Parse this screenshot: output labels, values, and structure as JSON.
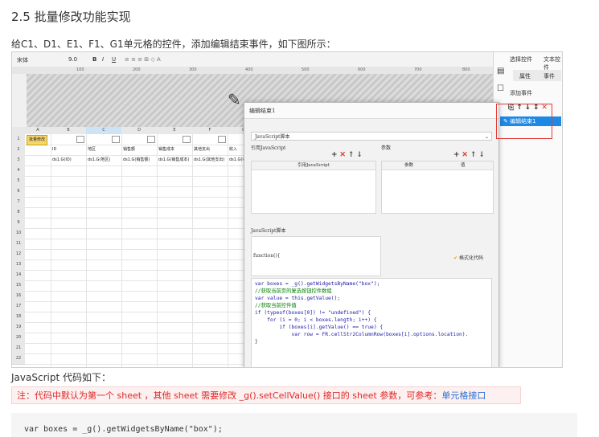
{
  "heading": "2.5 批量修改功能实现",
  "intro": "给C1、D1、E1、F1、G1单元格的控件，添加编辑结束事件，如下图所示：",
  "screenshot": {
    "toolbar": {
      "font_name": "宋体",
      "font_size": "9.0",
      "buttons": [
        "B",
        "I",
        "U"
      ]
    },
    "ruler_ticks": [
      "100",
      "200",
      "300",
      "400",
      "500",
      "600",
      "700",
      "800"
    ],
    "grid": {
      "col_headers": [
        "A",
        "B",
        "C",
        "D",
        "E",
        "F",
        "G"
      ],
      "rows": [
        {
          "num": "1",
          "cells": [
            "批量修改",
            "",
            "",
            "",
            "",
            "",
            ""
          ]
        },
        {
          "num": "2",
          "cells": [
            "",
            "ID",
            "地区",
            "销售额",
            "销售成本",
            "其他支出",
            "收入"
          ]
        },
        {
          "num": "3",
          "cells": [
            "",
            "ds1.G(ID)",
            "ds1.G(地区)",
            "ds1.G(销售额)",
            "ds1.G(销售成本)",
            "ds1.G(其他支出)",
            "ds1.G(收入)"
          ]
        },
        {
          "num": "4",
          "cells": []
        },
        {
          "num": "5",
          "cells": []
        },
        {
          "num": "6",
          "cells": []
        },
        {
          "num": "7",
          "cells": []
        },
        {
          "num": "8",
          "cells": []
        },
        {
          "num": "9",
          "cells": []
        },
        {
          "num": "10",
          "cells": []
        },
        {
          "num": "11",
          "cells": []
        },
        {
          "num": "12",
          "cells": []
        },
        {
          "num": "13",
          "cells": []
        },
        {
          "num": "14",
          "cells": []
        },
        {
          "num": "15",
          "cells": []
        },
        {
          "num": "16",
          "cells": []
        },
        {
          "num": "17",
          "cells": []
        },
        {
          "num": "18",
          "cells": []
        },
        {
          "num": "19",
          "cells": []
        },
        {
          "num": "20",
          "cells": []
        },
        {
          "num": "21",
          "cells": []
        },
        {
          "num": "22",
          "cells": []
        }
      ]
    },
    "right_panel": {
      "tabs": [
        "选择控件",
        "文本控件"
      ],
      "subtabs": [
        "属性",
        "事件"
      ],
      "add_event": "添加事件",
      "event_item": "编辑结束1"
    },
    "dialog": {
      "title": "编辑结束1",
      "script_type": "JavaScript脚本",
      "ref_js_label": "引用JavaScript",
      "params_label": "参数",
      "ref_js_col": "引用JavaScript",
      "param_col": "参数",
      "value_col": "值",
      "js_script_label": "JavaScript脚本",
      "function_sig": "function(){",
      "format_code": "格式化代码",
      "code_lines": [
        {
          "t": "var boxes = _g().getWidgetsByName(\"box\");",
          "c": "code"
        },
        {
          "t": "//获取当前页的复选按钮控件数组",
          "c": "cm"
        },
        {
          "t": "var value = this.getValue();",
          "c": "code"
        },
        {
          "t": "//获取当前控件值",
          "c": "cm"
        },
        {
          "t": "if (typeof(boxes[0]) != \"undefined\") {",
          "c": "code"
        },
        {
          "t": "    for (i = 0; i < boxes.length; i++) {",
          "c": "code"
        },
        {
          "t": "        if (boxes[i].getValue() == true) {",
          "c": "code"
        },
        {
          "t": "            var row = FR.cellStr2ColumnRow(boxes[i].options.location).",
          "c": "code"
        }
      ],
      "closing": "}"
    }
  },
  "js_title": "JavaScript 代码如下：",
  "note": {
    "text": "注：代码中默认为第一个 sheet ，其他 sheet 需要修改 _g().setCellValue() 接口的 sheet 参数，可参考：",
    "link": "单元格接口"
  },
  "code_first_line": "var  boxes  =  _g().getWidgetsByName(\"box\");",
  "colors": {
    "accent": "#2b6fd6",
    "note_red": "#e02828",
    "highlight": "#e53935"
  }
}
